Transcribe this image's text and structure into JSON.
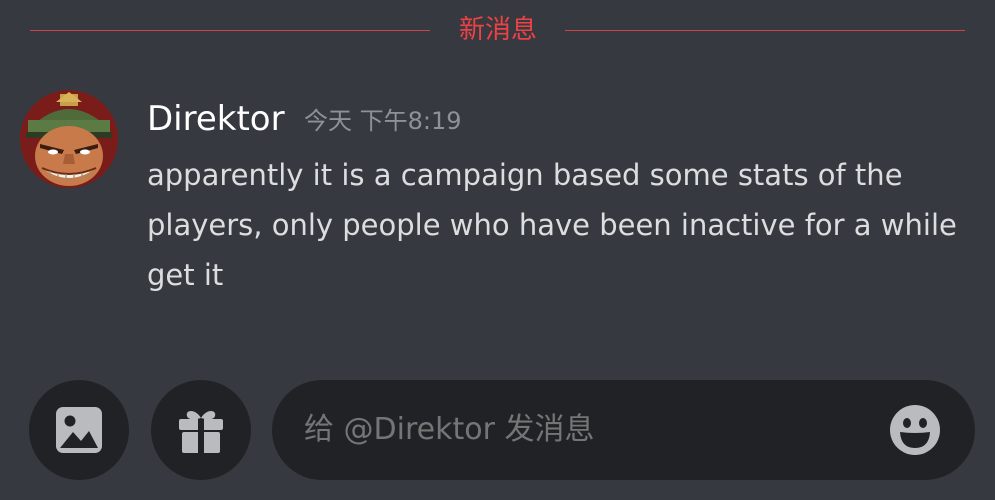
{
  "divider": {
    "label": "新消息",
    "color": "#ed4245"
  },
  "message": {
    "author": "Direktor",
    "timestamp": "今天 下午8:19",
    "text": "apparently it is a campaign based some stats of the players, only people who have been inactive for a while get it"
  },
  "composer": {
    "placeholder": "给 @Direktor 发消息"
  },
  "icons": {
    "image_button": "image-icon",
    "gift_button": "gift-icon",
    "emoji_button": "emoji-icon"
  },
  "colors": {
    "background": "#36393f",
    "input_background": "#202225",
    "icon_color": "#b9bbbe"
  }
}
